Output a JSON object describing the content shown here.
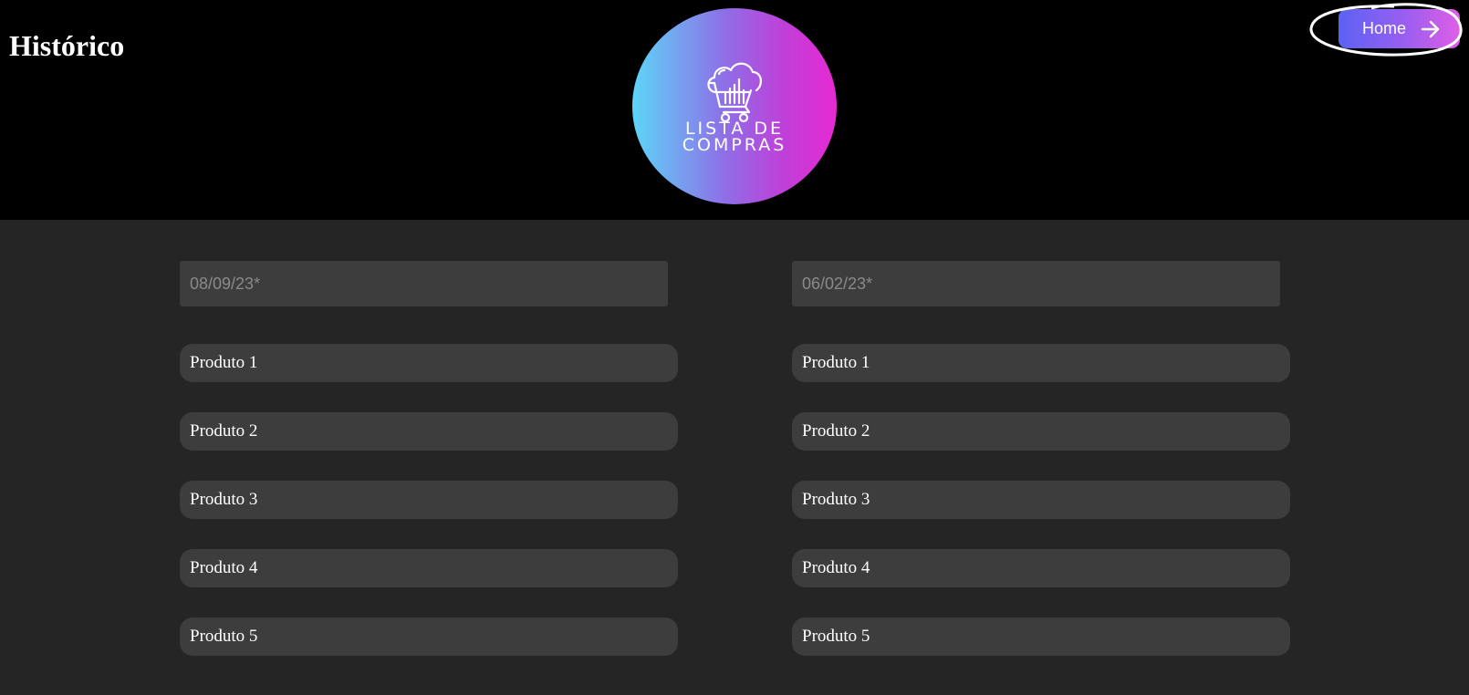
{
  "header": {
    "title": "Histórico",
    "logo": {
      "line1": "LISTA DE",
      "line2": "COMPRAS",
      "icon": "cloud-cart-icon"
    },
    "home_button": {
      "label": "Home",
      "icon": "arrow-right-icon"
    }
  },
  "lists": [
    {
      "date_placeholder": "08/09/23*",
      "products": [
        "Produto 1",
        "Produto 2",
        "Produto 3",
        "Produto 4",
        "Produto 5"
      ]
    },
    {
      "date_placeholder": "06/02/23*",
      "products": [
        "Produto 1",
        "Produto 2",
        "Produto 3",
        "Produto 4",
        "Produto 5"
      ]
    }
  ],
  "colors": {
    "header_bg": "#000000",
    "page_bg": "#252525",
    "field_bg": "#3d3d3d",
    "gradient_start": "#5dd5f8",
    "gradient_end": "#e72ad2"
  }
}
